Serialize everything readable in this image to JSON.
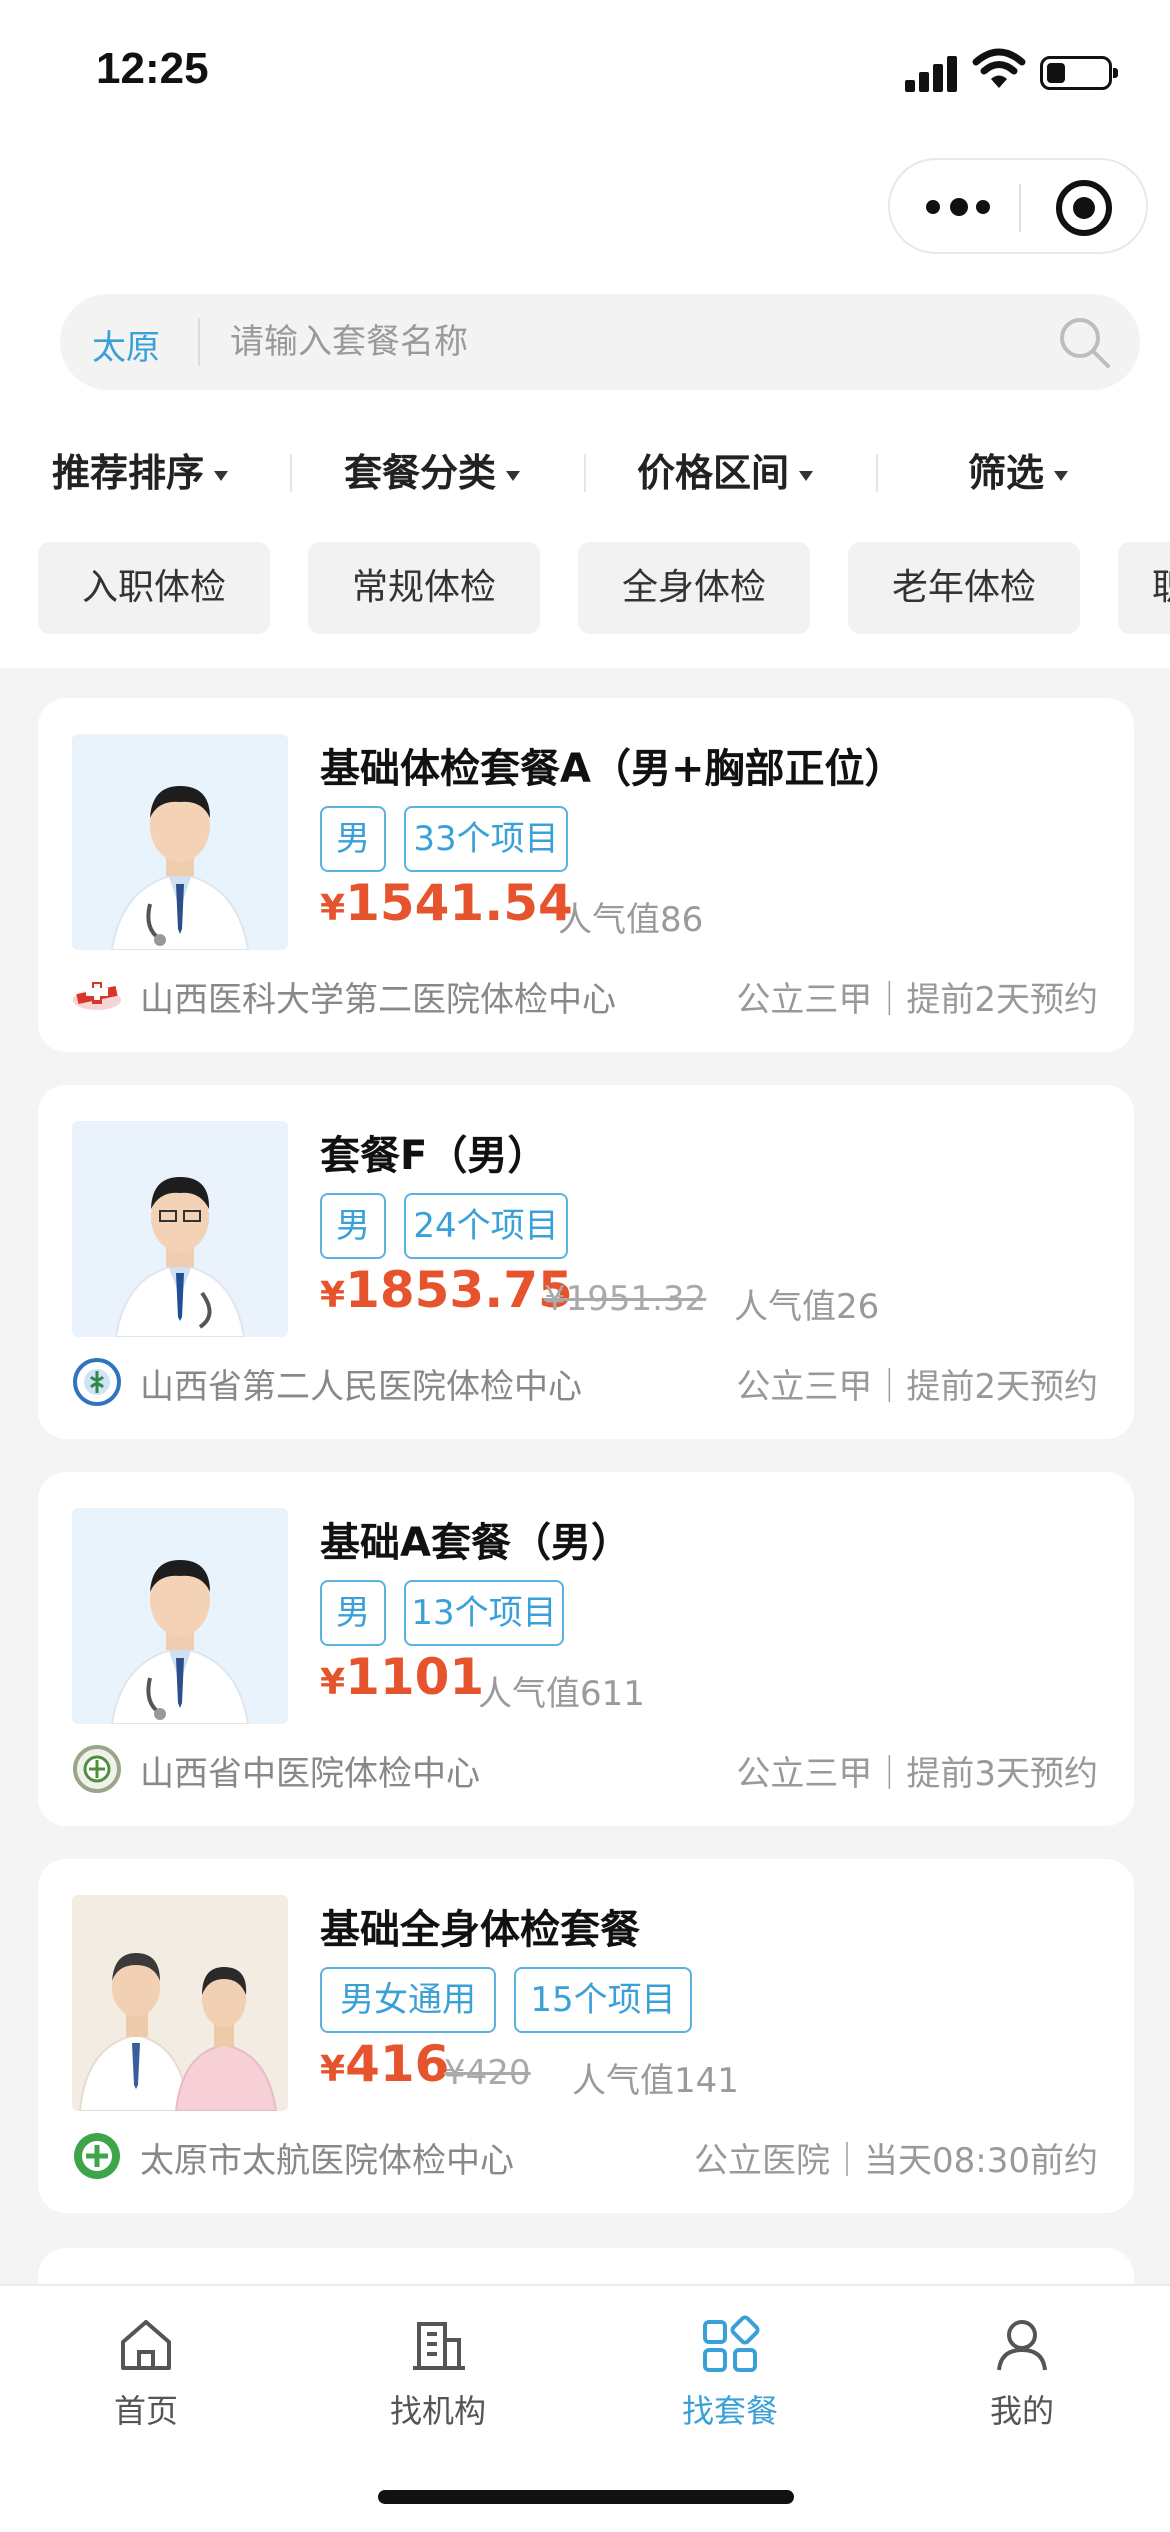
{
  "status_bar": {
    "time": "12:25"
  },
  "search": {
    "city": "太原",
    "placeholder": "请输入套餐名称"
  },
  "sort": [
    {
      "label": "推荐排序"
    },
    {
      "label": "套餐分类"
    },
    {
      "label": "价格区间"
    },
    {
      "label": "筛选"
    }
  ],
  "categories": [
    "入职体检",
    "常规体检",
    "全身体检",
    "老年体检",
    "职"
  ],
  "packages": [
    {
      "title": "基础体检套餐A（男+胸部正位）",
      "tags": [
        "男",
        "33个项目"
      ],
      "currency": "¥",
      "price": "1541.54",
      "original_price": "",
      "popularity": "人气值86",
      "hospital": "山西医科大学第二医院体检中心",
      "meta": "公立三甲｜提前2天预约"
    },
    {
      "title": "套餐F（男）",
      "tags": [
        "男",
        "24个项目"
      ],
      "currency": "¥",
      "price": "1853.75",
      "original_price": "¥1951.32",
      "popularity": "人气值26",
      "hospital": "山西省第二人民医院体检中心",
      "meta": "公立三甲｜提前2天预约"
    },
    {
      "title": "基础A套餐（男）",
      "tags": [
        "男",
        "13个项目"
      ],
      "currency": "¥",
      "price": "1101",
      "original_price": "",
      "popularity": "人气值611",
      "hospital": "山西省中医院体检中心",
      "meta": "公立三甲｜提前3天预约"
    },
    {
      "title": "基础全身体检套餐",
      "tags": [
        "男女通用",
        "15个项目"
      ],
      "currency": "¥",
      "price": "416",
      "original_price": "¥420",
      "popularity": "人气值141",
      "hospital": "太原市太航医院体检中心",
      "meta": "公立医院｜当天08:30前约"
    }
  ],
  "tabbar": [
    {
      "label": "首页",
      "icon": "home-icon"
    },
    {
      "label": "找机构",
      "icon": "building-icon"
    },
    {
      "label": "找套餐",
      "icon": "grid-icon",
      "active": true
    },
    {
      "label": "我的",
      "icon": "user-icon"
    }
  ],
  "colors": {
    "accent": "#3aa0d8",
    "price": "#e6542e"
  }
}
